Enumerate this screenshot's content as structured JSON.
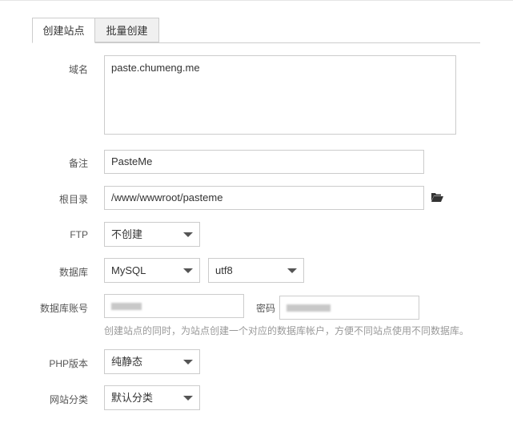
{
  "tabs": [
    {
      "label": "创建站点"
    },
    {
      "label": "批量创建"
    }
  ],
  "form": {
    "domain": {
      "label": "域名",
      "value": "paste.chumeng.me"
    },
    "remark": {
      "label": "备注",
      "value": "PasteMe"
    },
    "root": {
      "label": "根目录",
      "value": "/www/wwwroot/pasteme",
      "icon": "folder-open-icon"
    },
    "ftp": {
      "label": "FTP",
      "value": "不创建"
    },
    "database": {
      "label": "数据库",
      "type": "MySQL",
      "charset": "utf8"
    },
    "db_account": {
      "label": "数据库账号",
      "password_label": "密码",
      "hint": "创建站点的同时，为站点创建一个对应的数据库帐户，方便不同站点使用不同数据库。"
    },
    "php": {
      "label": "PHP版本",
      "value": "纯静态"
    },
    "category": {
      "label": "网站分类",
      "value": "默认分类"
    }
  }
}
